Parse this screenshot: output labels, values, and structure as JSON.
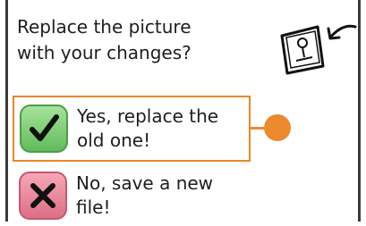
{
  "dialog": {
    "question": "Replace the picture\nwith your changes?"
  },
  "options": {
    "yes": {
      "label": "Yes, replace the\nold one!",
      "icon": "checkmark-icon",
      "color": "#62bb5c"
    },
    "no": {
      "label": "No, save a new\nfile!",
      "icon": "x-mark-icon",
      "color": "#dd6f86"
    }
  },
  "icons": {
    "picture": "picture-arrow-icon"
  },
  "colors": {
    "highlight": "#e8862a",
    "callout": "#ec8a2d"
  }
}
